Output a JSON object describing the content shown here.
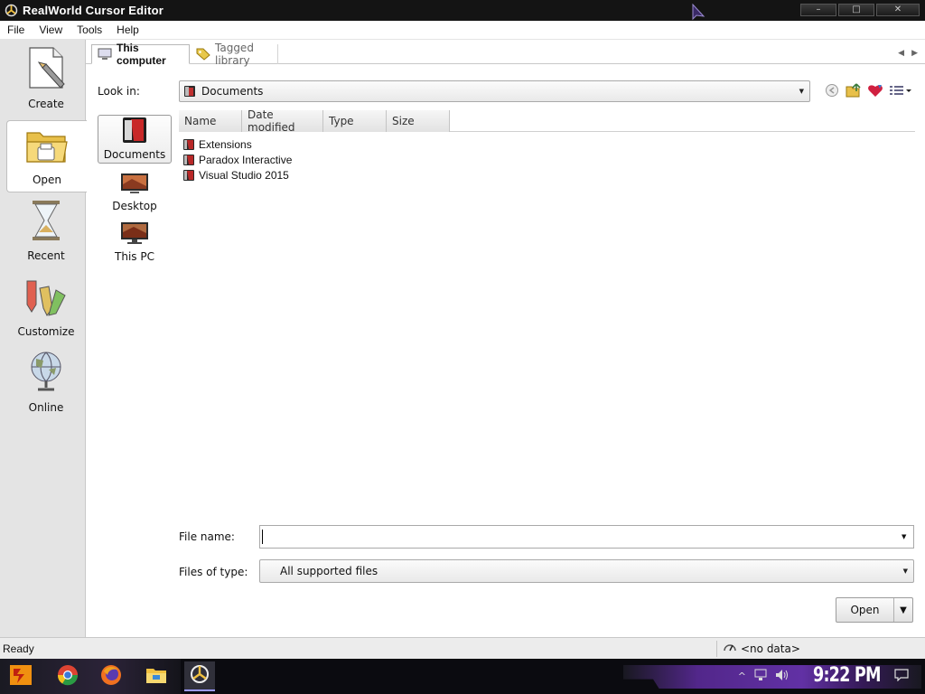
{
  "window": {
    "title": "RealWorld Cursor Editor",
    "controls": {
      "minimize": "–",
      "maximize": "□",
      "close": "✕"
    }
  },
  "menu": [
    "File",
    "View",
    "Tools",
    "Help"
  ],
  "sidebar": {
    "items": [
      {
        "label": "Create",
        "icon": "create-icon",
        "active": false
      },
      {
        "label": "Open",
        "icon": "folder-icon",
        "active": true
      },
      {
        "label": "Recent",
        "icon": "hourglass-icon",
        "active": false
      },
      {
        "label": "Customize",
        "icon": "pencils-icon",
        "active": false
      },
      {
        "label": "Online",
        "icon": "globe-icon",
        "active": false
      }
    ]
  },
  "tabs": [
    {
      "label": "This computer",
      "icon": "computer-icon",
      "active": true
    },
    {
      "label": "Tagged library",
      "icon": "tag-icon",
      "active": false
    }
  ],
  "look_in": {
    "label": "Look in:",
    "value": "Documents"
  },
  "places": [
    {
      "label": "Documents",
      "icon": "documents-icon",
      "active": true
    },
    {
      "label": "Desktop",
      "icon": "desktop-icon",
      "active": false
    },
    {
      "label": "This PC",
      "icon": "pc-icon",
      "active": false
    }
  ],
  "file_list": {
    "columns": [
      "Name",
      "Date modified",
      "Type",
      "Size"
    ],
    "rows": [
      {
        "name": "Extensions"
      },
      {
        "name": "Paradox Interactive"
      },
      {
        "name": "Visual Studio 2015"
      }
    ]
  },
  "file_name": {
    "label": "File name:",
    "value": ""
  },
  "files_of_type": {
    "label": "Files of type:",
    "value": "All supported files"
  },
  "open_button": {
    "label": "Open"
  },
  "status": {
    "text": "Ready",
    "right": "<no data>"
  },
  "taskbar": {
    "clock": "9:22 PM"
  },
  "colors": {
    "titlebar": "#141414",
    "sidebar": "#e4e4e4",
    "taskbar_accent": "#6b35b5"
  }
}
